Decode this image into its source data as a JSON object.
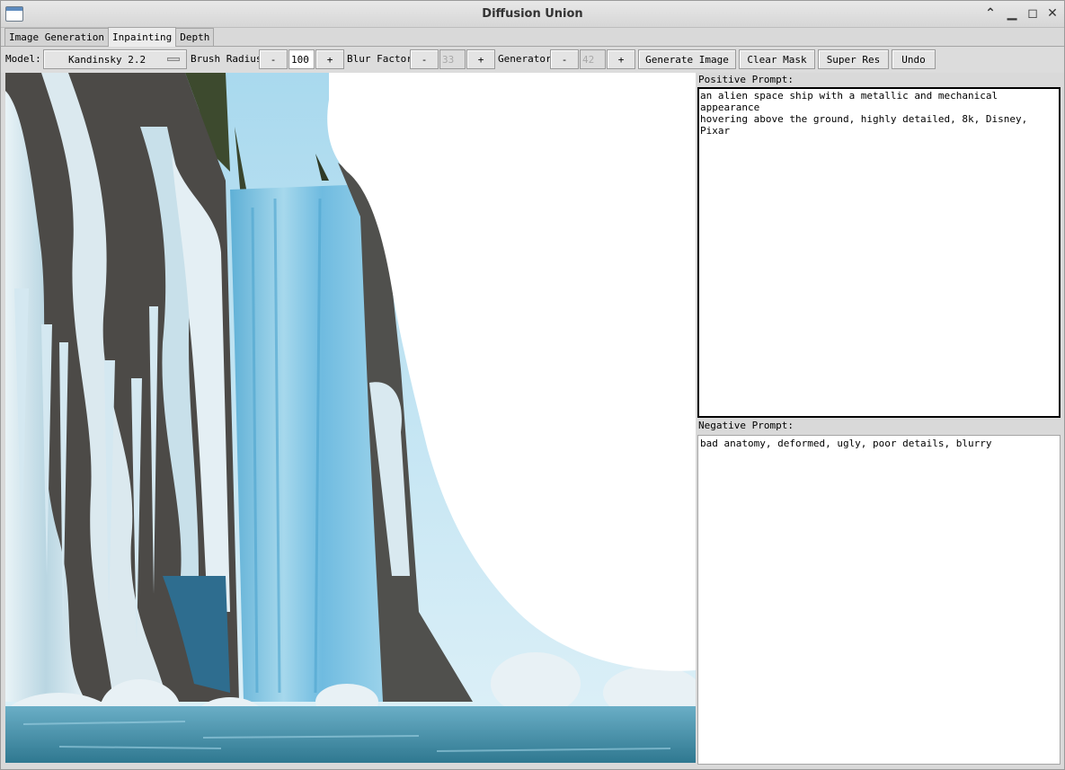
{
  "window": {
    "title": "Diffusion Union",
    "controls": {
      "minimize": "▁",
      "maximize": "◻",
      "close": "✕",
      "shade": "⌃"
    }
  },
  "tabs": [
    {
      "label": "Image Generation"
    },
    {
      "label": "Inpainting"
    },
    {
      "label": "Depth"
    }
  ],
  "toolbar": {
    "model_label": "Model:",
    "model_value": "Kandinsky 2.2",
    "brush_radius_label": "Brush Radius",
    "brush_radius_value": "100",
    "blur_factor_label": "Blur Factor",
    "blur_factor_value": "33",
    "generator_label": "Generator",
    "generator_value": "42",
    "minus": "-",
    "plus": "+",
    "generate_label": "Generate Image",
    "clear_mask_label": "Clear Mask",
    "super_res_label": "Super Res",
    "undo_label": "Undo"
  },
  "prompts": {
    "positive_label": "Positive Prompt:",
    "positive_value": "an alien space ship with a metallic and mechanical appearance\nhovering above the ground, highly detailed, 8k, Disney, Pixar",
    "negative_label": "Negative Prompt:",
    "negative_value": "bad anatomy, deformed, ugly, poor details, blurry"
  },
  "colors": {
    "ice_light": "#dfeef5",
    "ice_blue": "#7ec3e0",
    "water": "#4c8fa8",
    "rock": "#4a4a48",
    "sky": "#bfe4f2",
    "mask": "#ffffff"
  }
}
